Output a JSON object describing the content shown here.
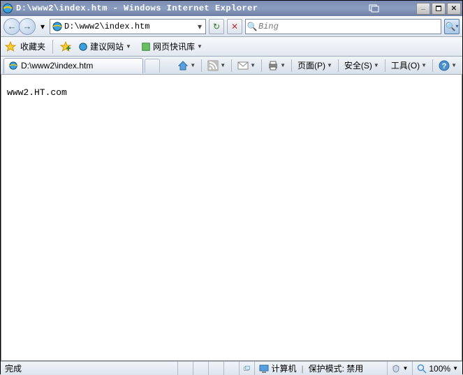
{
  "title": "D:\\www2\\index.htm - Windows Internet Explorer",
  "address": "D:\\www2\\index.htm",
  "search_placeholder": "Bing",
  "favorites_label": "收藏夹",
  "fav_items": [
    "建议网站",
    "网页快讯库"
  ],
  "tab_title": "D:\\www2\\index.htm",
  "tools": {
    "page": "页面(P)",
    "safety": "安全(S)",
    "tools": "工具(O)"
  },
  "body_text": "www2.HT.com",
  "status": {
    "done": "完成",
    "zone": "计算机",
    "protected": "保护模式: 禁用",
    "zoom": "100%"
  }
}
